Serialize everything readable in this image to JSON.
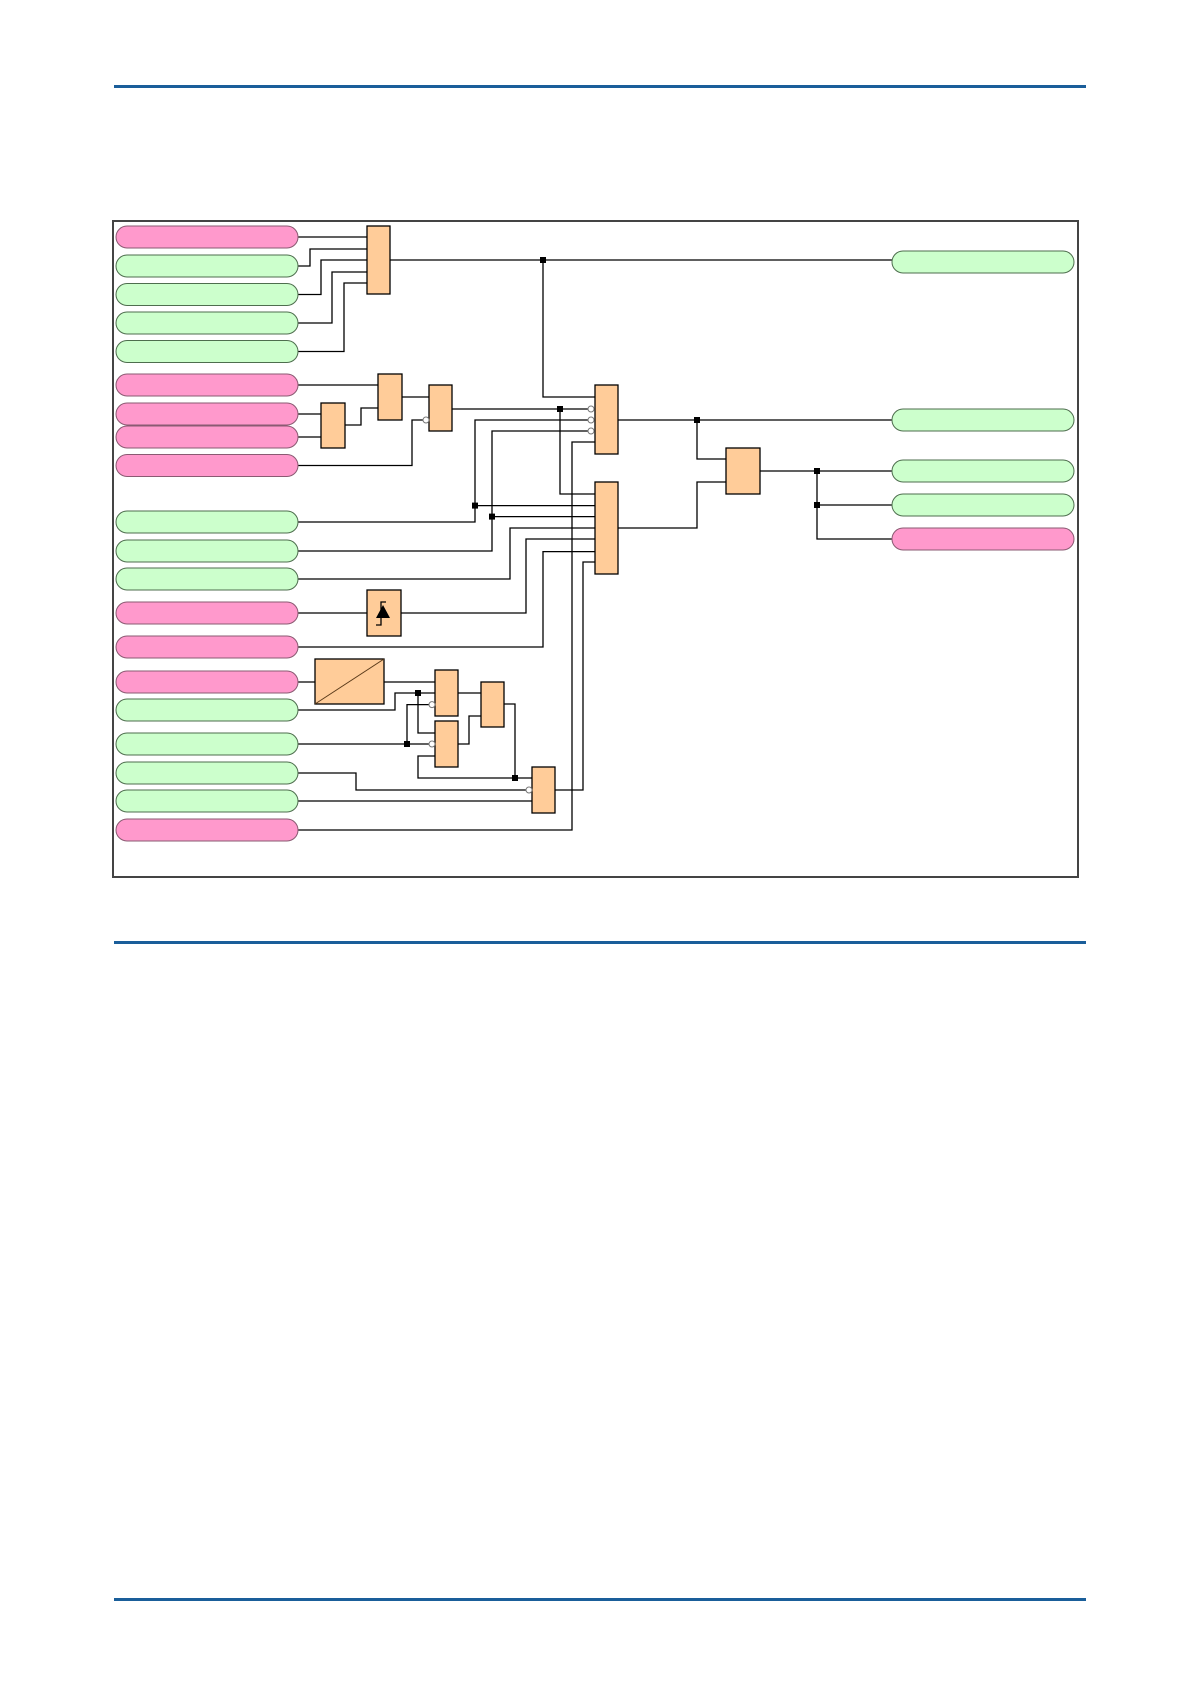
{
  "colors": {
    "rule": "#1a5e9a",
    "input_signal_pink": "#ff99cc",
    "input_signal_green": "#ccffcc",
    "gate_fill": "#ffcc99",
    "frame": "#444444"
  },
  "diagram": {
    "left_signals": [
      "pink",
      "green",
      "green",
      "green",
      "green",
      "pink",
      "pink",
      "pink",
      "pink",
      "green",
      "green",
      "green",
      "pink",
      "pink",
      "pink",
      "green",
      "green",
      "green",
      "green",
      "pink"
    ],
    "right_signals": [
      "green",
      "green",
      "green",
      "green",
      "pink"
    ],
    "icons": [
      "edge-detector-icon",
      "converter-icon"
    ]
  }
}
